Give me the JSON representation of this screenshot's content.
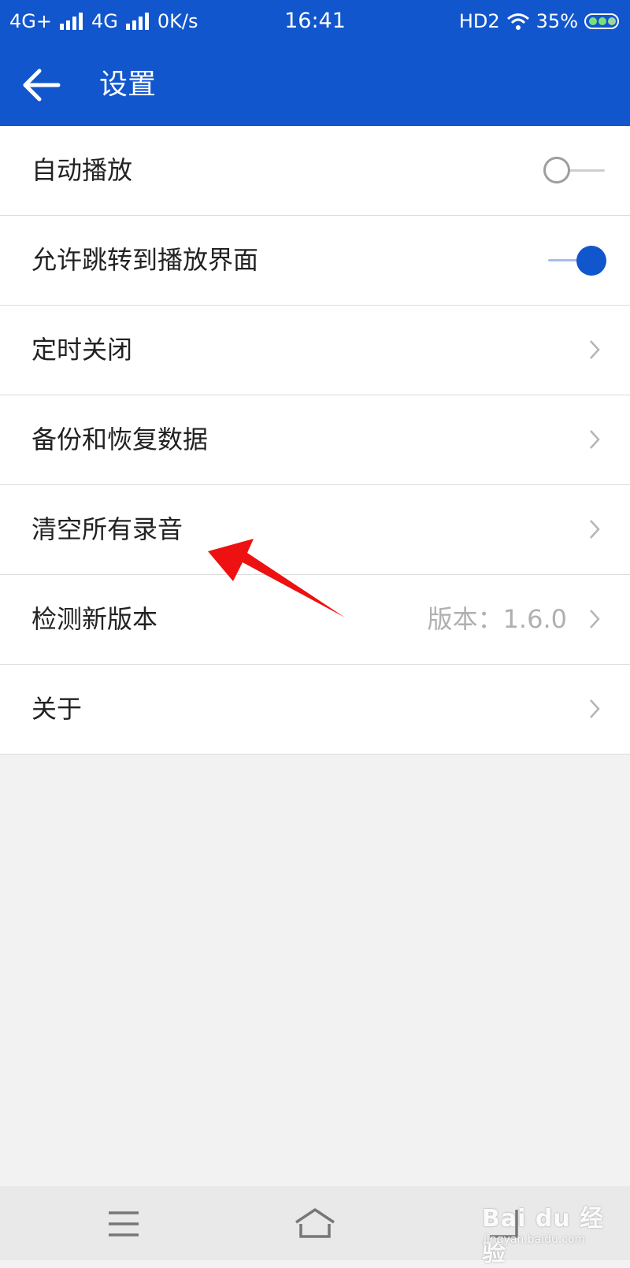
{
  "status_bar": {
    "net1": "4G+",
    "net2": "4G",
    "speed": "0K/s",
    "time": "16:41",
    "hd": "HD2",
    "battery": "35%"
  },
  "header": {
    "back_icon": "arrow-left-icon",
    "title": "设置"
  },
  "settings": {
    "auto_play": {
      "label": "自动播放",
      "enabled": false
    },
    "allow_jump": {
      "label": "允许跳转到播放界面",
      "enabled": true
    },
    "timer_close": {
      "label": "定时关闭"
    },
    "backup_restore": {
      "label": "备份和恢复数据"
    },
    "clear_recordings": {
      "label": "清空所有录音"
    },
    "check_version": {
      "label": "检测新版本",
      "value": "版本：1.6.0"
    },
    "about": {
      "label": "关于"
    }
  },
  "annotation": {
    "color": "#ee1111",
    "icon": "red-arrow-pointer"
  },
  "nav_bar": {
    "icons": [
      "menu-icon",
      "home-icon",
      "back-icon"
    ]
  },
  "watermark": {
    "brand": "Bai du 经验",
    "url": "jingyan.baidu.com"
  },
  "colors": {
    "primary": "#1156cc",
    "background": "#f2f2f2",
    "divider": "#dcdcdc"
  }
}
